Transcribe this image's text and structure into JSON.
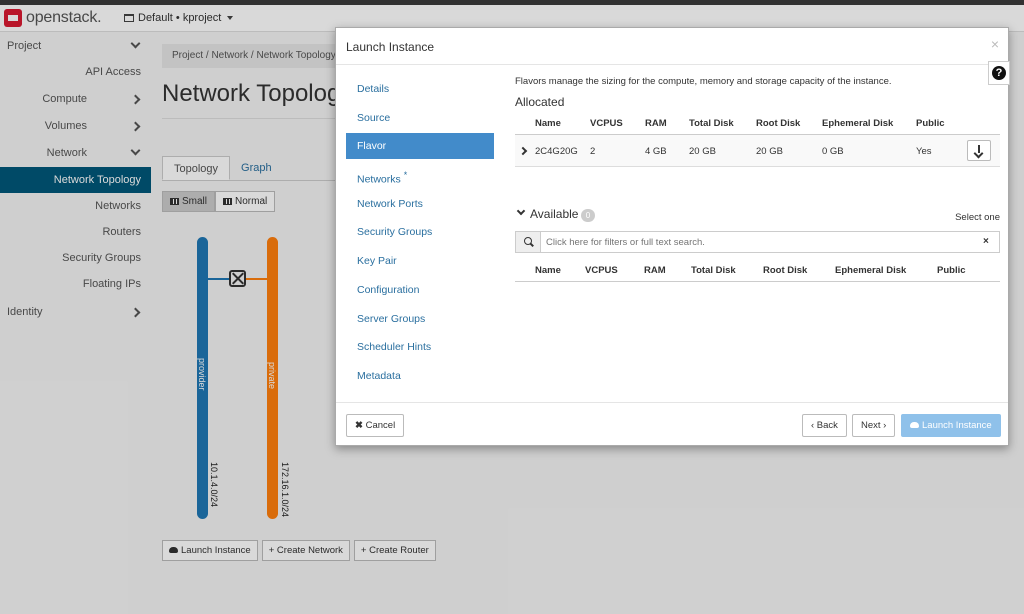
{
  "header": {
    "brand": "openstack.",
    "project_selector": "Default • kproject"
  },
  "sidebar": {
    "items": [
      {
        "label": "Project"
      },
      {
        "label": "API Access"
      },
      {
        "label": "Compute"
      },
      {
        "label": "Volumes"
      },
      {
        "label": "Network"
      },
      {
        "label": "Network Topology"
      },
      {
        "label": "Networks"
      },
      {
        "label": "Routers"
      },
      {
        "label": "Security Groups"
      },
      {
        "label": "Floating IPs"
      },
      {
        "label": "Identity"
      }
    ]
  },
  "main": {
    "breadcrumb": "Project /  Network /  Network Topology",
    "title": "Network Topology",
    "tabs": [
      "Topology",
      "Graph"
    ],
    "size_buttons": [
      "Small",
      "Normal"
    ],
    "networks": [
      {
        "name": "provider",
        "cidr": "10.1.4.0/24",
        "color": "#1f77b4"
      },
      {
        "name": "private",
        "cidr": "172.16.1.0/24",
        "color": "#ff7f0e"
      }
    ],
    "actions": [
      "Launch Instance",
      "+ Create Network",
      "+ Create Router"
    ]
  },
  "modal": {
    "title": "Launch Instance",
    "close": "×",
    "help": "?",
    "steps": [
      {
        "label": "Details"
      },
      {
        "label": "Source"
      },
      {
        "label": "Flavor"
      },
      {
        "label": "Networks",
        "required": "*"
      },
      {
        "label": "Network Ports"
      },
      {
        "label": "Security Groups"
      },
      {
        "label": "Key Pair"
      },
      {
        "label": "Configuration"
      },
      {
        "label": "Server Groups"
      },
      {
        "label": "Scheduler Hints"
      },
      {
        "label": "Metadata"
      }
    ],
    "flavor": {
      "description": "Flavors manage the sizing for the compute, memory and storage capacity of the instance.",
      "allocated_title": "Allocated",
      "columns": [
        "Name",
        "VCPUS",
        "RAM",
        "Total Disk",
        "Root Disk",
        "Ephemeral Disk",
        "Public"
      ],
      "allocated_rows": [
        {
          "name": "2C4G20G",
          "vcpus": "2",
          "ram": "4 GB",
          "total_disk": "20 GB",
          "root_disk": "20 GB",
          "ephemeral_disk": "0 GB",
          "public": "Yes"
        }
      ],
      "available_title": "Available",
      "available_count": "0",
      "select_one": "Select one",
      "filter_placeholder": "Click here for filters or full text search.",
      "filter_clear": "×"
    },
    "footer": {
      "cancel": "Cancel",
      "back": "‹ Back",
      "next": "Next ›",
      "launch": "Launch Instance"
    }
  }
}
